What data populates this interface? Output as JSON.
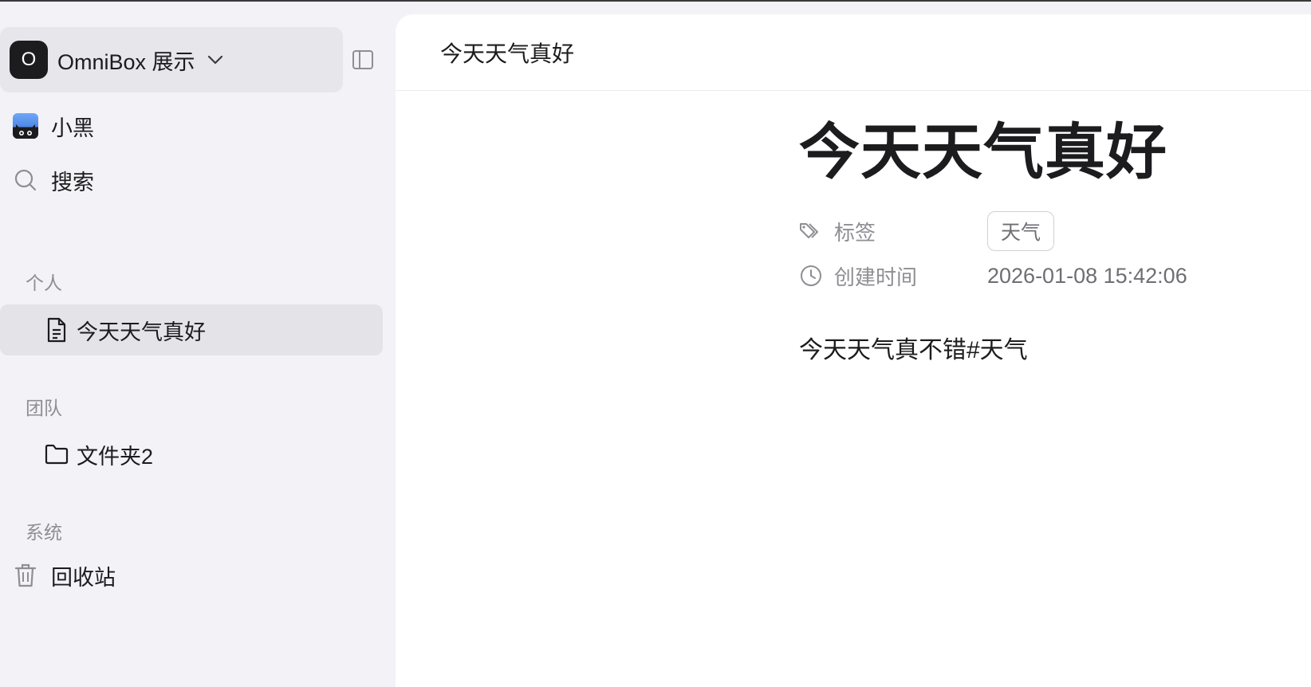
{
  "workspace": {
    "avatar_letter": "O",
    "name": "OmniBox 展示"
  },
  "sidebar": {
    "user": {
      "name": "小黑"
    },
    "search_label": "搜索",
    "sections": {
      "personal": {
        "label": "个人",
        "items": [
          {
            "label": "今天天气真好",
            "icon": "document-icon"
          }
        ]
      },
      "team": {
        "label": "团队",
        "items": [
          {
            "label": "文件夹2",
            "icon": "folder-icon"
          }
        ]
      },
      "system": {
        "label": "系统",
        "items": [
          {
            "label": "回收站",
            "icon": "trash-icon"
          }
        ]
      }
    }
  },
  "main": {
    "header_title": "今天天气真好",
    "doc": {
      "title": "今天天气真好",
      "properties": {
        "tags": {
          "label": "标签",
          "values": [
            "天气"
          ]
        },
        "created": {
          "label": "创建时间",
          "value": "2026-01-08 15:42:06"
        }
      },
      "body": "今天天气真不错#天气"
    }
  },
  "colors": {
    "sidebar_bg": "#f2f2f7",
    "active_item_bg": "#e3e3e8",
    "workspace_bg": "#e6e6eb",
    "muted_text": "#8e8e93"
  }
}
